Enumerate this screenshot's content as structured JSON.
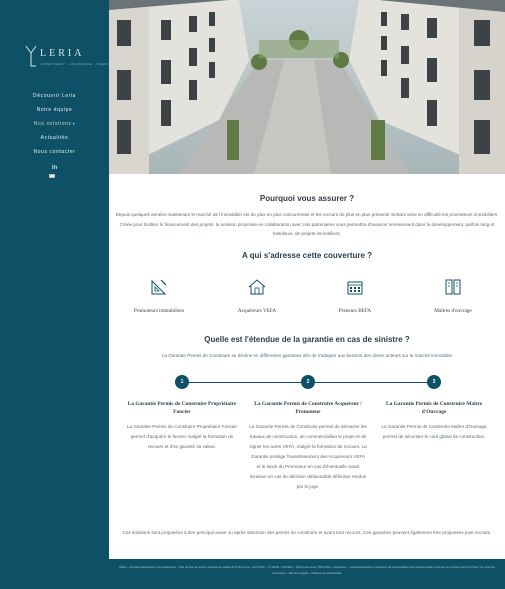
{
  "brand": {
    "name": "LERIA",
    "tagline": "INVESTMENT · ASSURANCE · CREDIT"
  },
  "nav": {
    "items": [
      {
        "label": "Découvrir Leria"
      },
      {
        "label": "Notre équipe"
      },
      {
        "label": "Nos solutions",
        "caret": "▾"
      },
      {
        "label": "Actualités"
      },
      {
        "label": "Nous contacter"
      }
    ],
    "active_index": 2
  },
  "social": {
    "linkedin": "in"
  },
  "icons": {
    "logo": "leria-logo-icon",
    "linkedin": "linkedin-icon",
    "language": "flag-icon",
    "promoters": "blueprint-icon",
    "buyers": "house-icon",
    "lenders": "building-icon",
    "owners": "documents-icon"
  },
  "colors": {
    "sidebar": "#0e5166",
    "accent": "#0e5166",
    "footer": "#0e5166"
  },
  "section1": {
    "title": "Pourquoi vous assurer ?",
    "text": "Depuis quelques années maintenant le marché de l'immobilier est de plus en plus concurrentiel et les recours de plus en plus présents mettant ainsi en difficulté les promoteurs immobiliers. Créée pour faciliter le financement des projets, la solution proposée en collaboration avec nos partenaires vous permettra d'avancer sereinement dans le développement, parfois long et fastidieux, de projets immobiliers."
  },
  "section2": {
    "title": "A qui s'adresse cette couverture ?",
    "audiences": [
      "Promoteurs immobiliers",
      "Acquéreurs VEFA",
      "Preneurs BEFA",
      "Maîtres d'ouvrage"
    ]
  },
  "section3": {
    "title": "Quelle est l'étendue de la garantie en cas de sinistre ?",
    "subtitle": "La Garantie Permis de Construire se décline en différentes garanties afin de s'adapter aux besoins des divers acteurs sur le marché immobilier",
    "columns": [
      {
        "step": "1",
        "title": "La Garantie Permis de Construire Propriétaire Foncier",
        "text": "La Garantie Permis de Construire Propriétaire Foncier permet d'acquérir le foncier malgré la formation de recours et d'en garantir sa valeur."
      },
      {
        "step": "2",
        "title": "La Garantie Permis de Construire Acquéreur / Promoteur",
        "text": "La Garantie Permis de Construire permet de démarrer les travaux de construction, de commercialiser le projet et de signer les actes VEFA, malgré la formation de recours. La Garantie protège l'investissement des Acquéreurs VEFA et le stock du Promoteur en cas d'éventuelle avant livraison en cas de décision défavorable définitive rendue par le juge."
      },
      {
        "step": "3",
        "title": "La Garantie Permis de Construire Maître d'Ouvrage",
        "text": "La Garantie Permis de Construire Maître d'Ouvrage permet de sécuriser le coût global de construction."
      }
    ],
    "outro": "Ces solutions sont proposées à titre principal avant ou après obtention des permis de construire et avant tout recours. Ces garanties peuvent également être proposées post recours."
  },
  "footer": {
    "text": "LERIA – Courtage d'assurance et de réassurance – SAS Société par actions simplifiée au capital de 15 000 euros – RCS Paris – N° ORIAS : 21003910 – 8 Rue Lamennais 75008 Paris – www.leria.fr – Garantie financière et assurance de responsabilité civile professionnelle conformes aux articles L512-6 et L512-7 du Code des Assurances – Mentions légales – Politique de confidentialité"
  }
}
